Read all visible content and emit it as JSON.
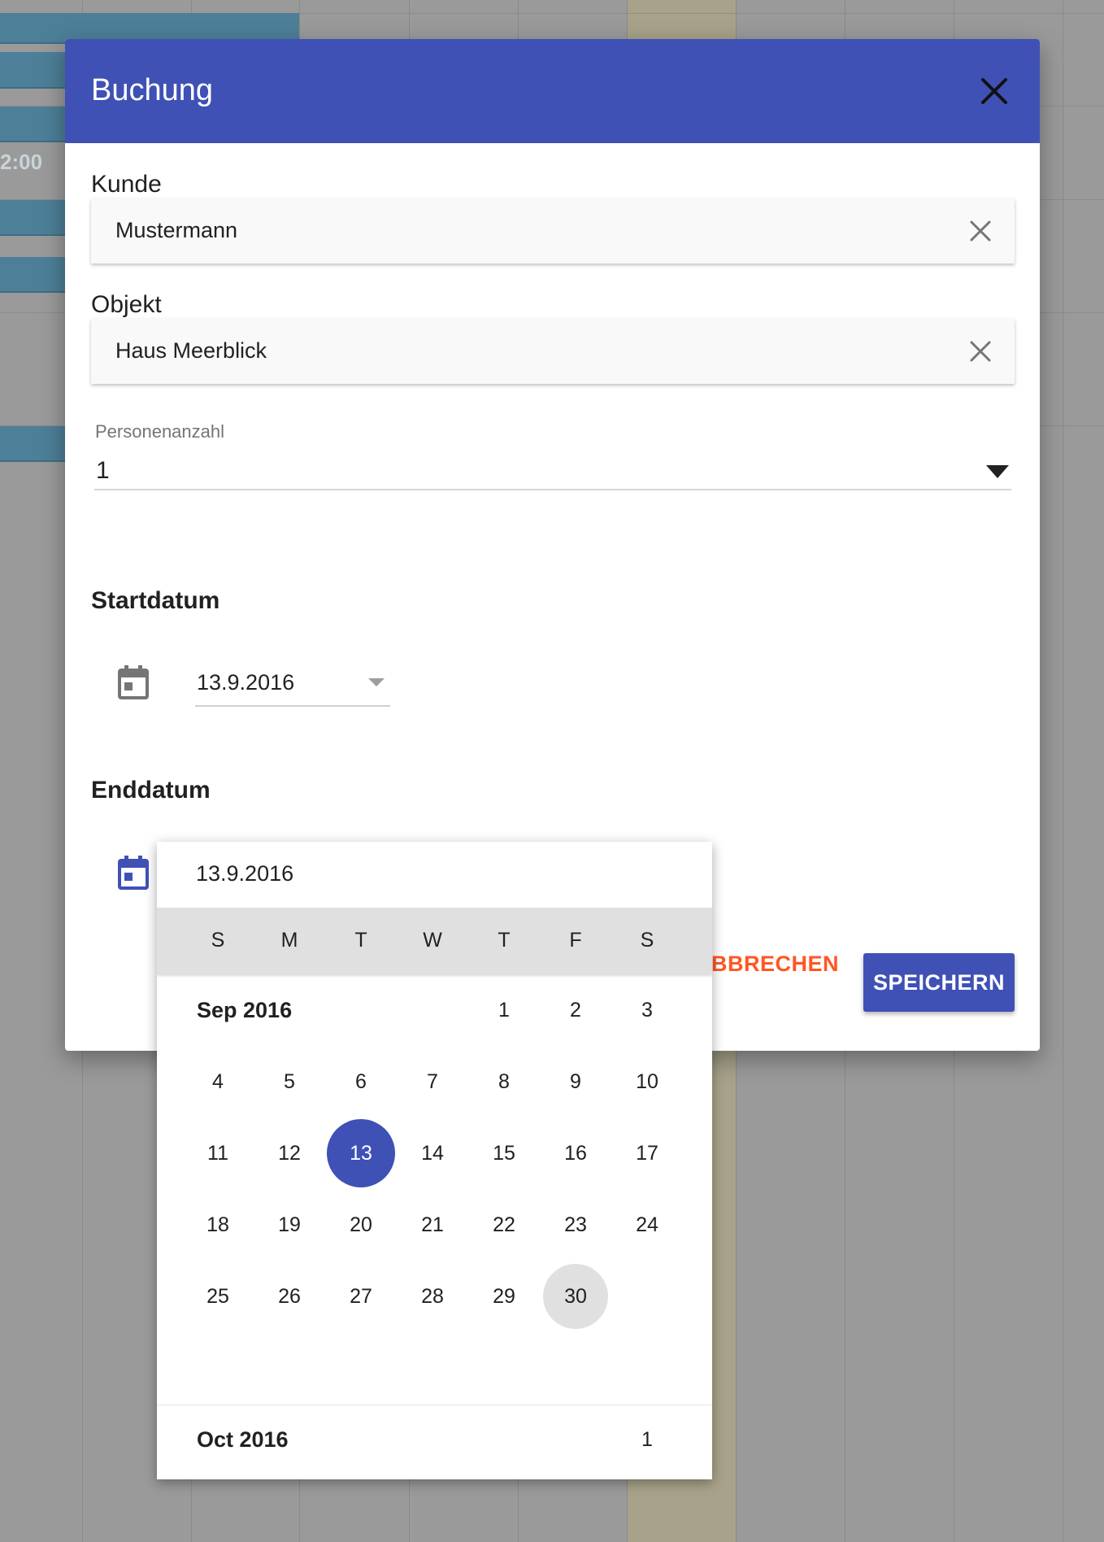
{
  "background": {
    "time_label": "2:00"
  },
  "dialog": {
    "title": "Buchung",
    "close_icon": "close-icon",
    "customer": {
      "label": "Kunde",
      "value": "Mustermann"
    },
    "object": {
      "label": "Objekt",
      "value": "Haus Meerblick"
    },
    "persons": {
      "label": "Personenanzahl",
      "value": "1"
    },
    "start": {
      "label": "Startdatum",
      "value": "13.9.2016"
    },
    "end": {
      "label": "Enddatum",
      "value": "13.9.2016"
    },
    "cancel_label": "BBRECHEN",
    "save_label": "SPEICHERN"
  },
  "picker": {
    "input_value": "13.9.2016",
    "weekdays": [
      "S",
      "M",
      "T",
      "W",
      "T",
      "F",
      "S"
    ],
    "months": [
      {
        "label": "Sep 2016",
        "weeks": [
          [
            "",
            "",
            "",
            "",
            "1",
            "2",
            "3"
          ],
          [
            "4",
            "5",
            "6",
            "7",
            "8",
            "9",
            "10"
          ],
          [
            "11",
            "12",
            "13",
            "14",
            "15",
            "16",
            "17"
          ],
          [
            "18",
            "19",
            "20",
            "21",
            "22",
            "23",
            "24"
          ],
          [
            "25",
            "26",
            "27",
            "28",
            "29",
            "30",
            ""
          ]
        ],
        "selected": "13",
        "hovered": "30"
      },
      {
        "label": "Oct 2016",
        "weeks": [
          [
            "",
            "",
            "",
            "",
            "",
            "",
            "1"
          ]
        ]
      }
    ]
  },
  "colors": {
    "primary": "#3f51b5",
    "accent": "#ff5722"
  }
}
